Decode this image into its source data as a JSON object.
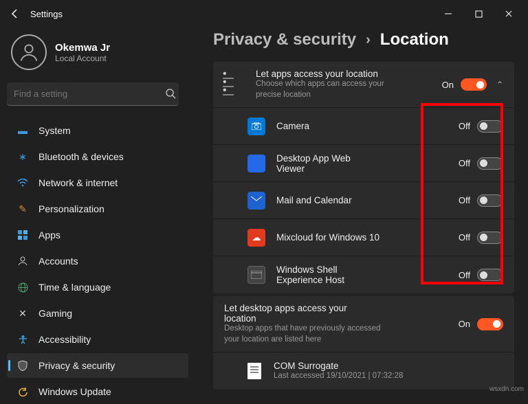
{
  "window": {
    "title": "Settings"
  },
  "user": {
    "name": "Okemwa Jr",
    "sub": "Local Account"
  },
  "search": {
    "placeholder": "Find a setting"
  },
  "nav": {
    "items": [
      {
        "label": "System"
      },
      {
        "label": "Bluetooth & devices"
      },
      {
        "label": "Network & internet"
      },
      {
        "label": "Personalization"
      },
      {
        "label": "Apps"
      },
      {
        "label": "Accounts"
      },
      {
        "label": "Time & language"
      },
      {
        "label": "Gaming"
      },
      {
        "label": "Accessibility"
      },
      {
        "label": "Privacy & security"
      },
      {
        "label": "Windows Update"
      }
    ]
  },
  "breadcrumb": {
    "parent": "Privacy & security",
    "sep": "›",
    "current": "Location"
  },
  "header_row": {
    "title": "Let apps access your location",
    "sub": "Choose which apps can access your precise location",
    "state": "On"
  },
  "apps": [
    {
      "label": "Camera",
      "state": "Off"
    },
    {
      "label": "Desktop App Web Viewer",
      "state": "Off"
    },
    {
      "label": "Mail and Calendar",
      "state": "Off"
    },
    {
      "label": "Mixcloud for Windows 10",
      "state": "Off"
    },
    {
      "label": "Windows Shell Experience Host",
      "state": "Off"
    }
  ],
  "desktop_section": {
    "title": "Let desktop apps access your location",
    "sub": "Desktop apps that have previously accessed your location are listed here",
    "state": "On",
    "entry": {
      "name": "COM Surrogate",
      "sub": "Last accessed 19/10/2021 | 07:32:28"
    }
  },
  "watermark": "wsxdn.com"
}
